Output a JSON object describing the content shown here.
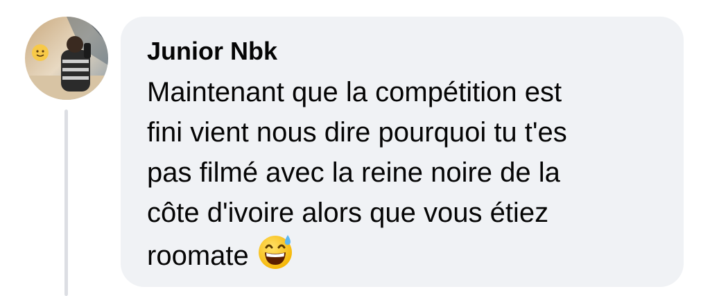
{
  "comment": {
    "author": "Junior Nbk",
    "text_lines": [
      "Maintenant que la compétition est",
      "fini vient nous dire pourquoi tu t'es",
      "pas filmé avec la reine noire de la",
      "côte d'ivoire alors que vous étiez",
      "roomate"
    ],
    "emoji": "grinning-face-with-sweat-icon"
  },
  "colors": {
    "bubble_background": "#f0f2f5",
    "text": "#050505",
    "thread_line": "#dcdee3"
  }
}
